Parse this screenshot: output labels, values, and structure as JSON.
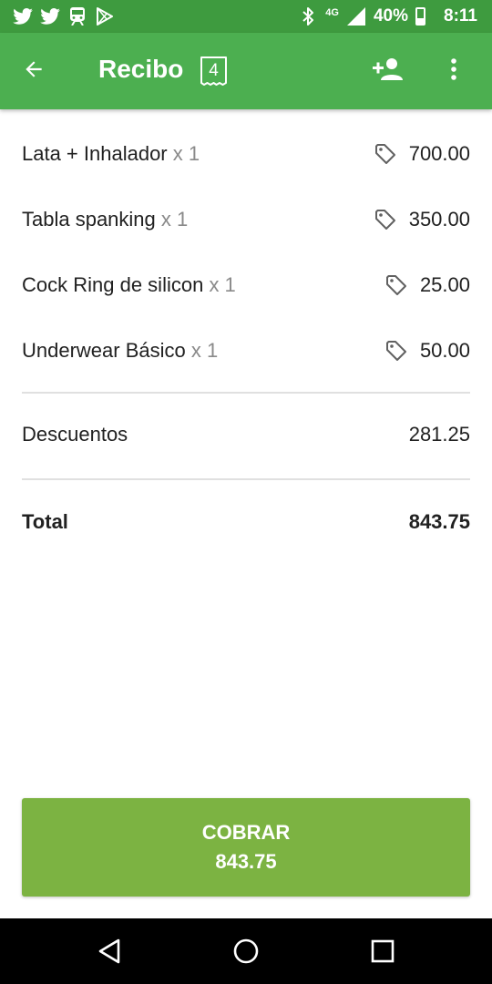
{
  "status_bar": {
    "network": "4G",
    "battery_text": "40%",
    "battery_level": 0.4,
    "time": "8:11",
    "notification_icons": [
      "twitter-icon",
      "twitter-icon",
      "train-icon",
      "play-store-icon"
    ]
  },
  "app_bar": {
    "title": "Recibo",
    "receipt_count": "4",
    "icons": {
      "back": "arrow-left-icon",
      "add_customer": "person-add-icon",
      "more": "more-vertical-icon"
    }
  },
  "items": [
    {
      "name": "Lata + Inhalador",
      "qty": "x 1",
      "price": "700.00"
    },
    {
      "name": "Tabla spanking",
      "qty": "x 1",
      "price": "350.00"
    },
    {
      "name": "Cock Ring de silicon",
      "qty": "x 1",
      "price": "25.00"
    },
    {
      "name": "Underwear Básico",
      "qty": "x 1",
      "price": "50.00"
    }
  ],
  "discounts": {
    "label": "Descuentos",
    "value": "281.25"
  },
  "total": {
    "label": "Total",
    "value": "843.75"
  },
  "charge_button": {
    "label": "COBRAR",
    "amount": "843.75"
  },
  "colors": {
    "status_bar": "#3e9b3f",
    "app_bar": "#4caf50",
    "charge_button": "#7cb342",
    "qty_text": "#8a8a8a"
  }
}
